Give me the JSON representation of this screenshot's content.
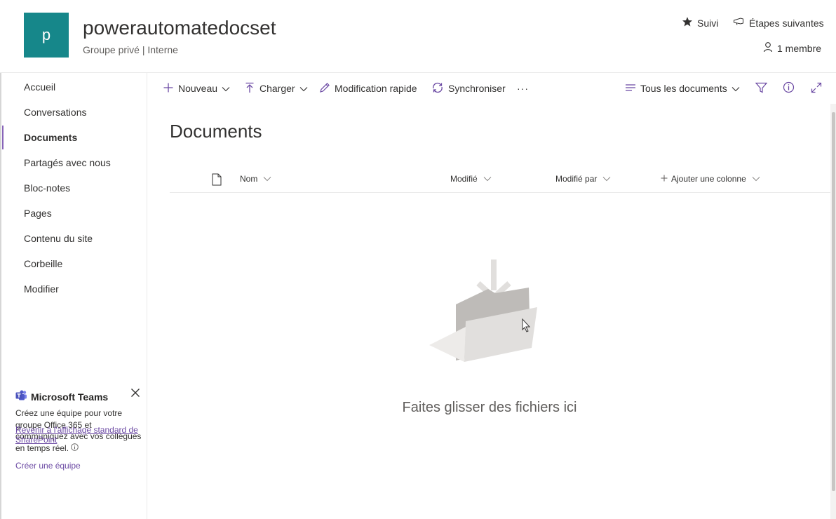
{
  "site": {
    "logo_letter": "p",
    "title": "powerautomatedocset",
    "subtitle": "Groupe privé | Interne",
    "follow_label": "Suivi",
    "next_steps_label": "Étapes suivantes",
    "members_label": "1 membre"
  },
  "nav": {
    "items": [
      {
        "label": "Accueil"
      },
      {
        "label": "Conversations"
      },
      {
        "label": "Documents"
      },
      {
        "label": "Partagés avec nous"
      },
      {
        "label": "Bloc-notes"
      },
      {
        "label": "Pages"
      },
      {
        "label": "Contenu du site"
      },
      {
        "label": "Corbeille"
      },
      {
        "label": "Modifier"
      }
    ],
    "selected": "Documents"
  },
  "teams": {
    "title": "Microsoft Teams",
    "body": "Créez une équipe pour votre groupe Office 365 et communiquez avec vos collègues en temps réel.",
    "create_link": "Créer une équipe",
    "classic_link": "Revenir à l'affichage standard de SharePoint"
  },
  "toolbar": {
    "new_label": "Nouveau",
    "upload_label": "Charger",
    "quick_edit_label": "Modification rapide",
    "sync_label": "Synchroniser",
    "more_label": "···",
    "view_label": "Tous les documents"
  },
  "main": {
    "title": "Documents",
    "columns": {
      "name": "Nom",
      "modified": "Modifié",
      "modified_by": "Modifié par",
      "add_column": "Ajouter une colonne"
    },
    "empty_text": "Faites glisser des fichiers ici"
  },
  "colors": {
    "accent": "#16878a",
    "nav_indicator": "#8764b8",
    "link": "#6b49a3"
  }
}
